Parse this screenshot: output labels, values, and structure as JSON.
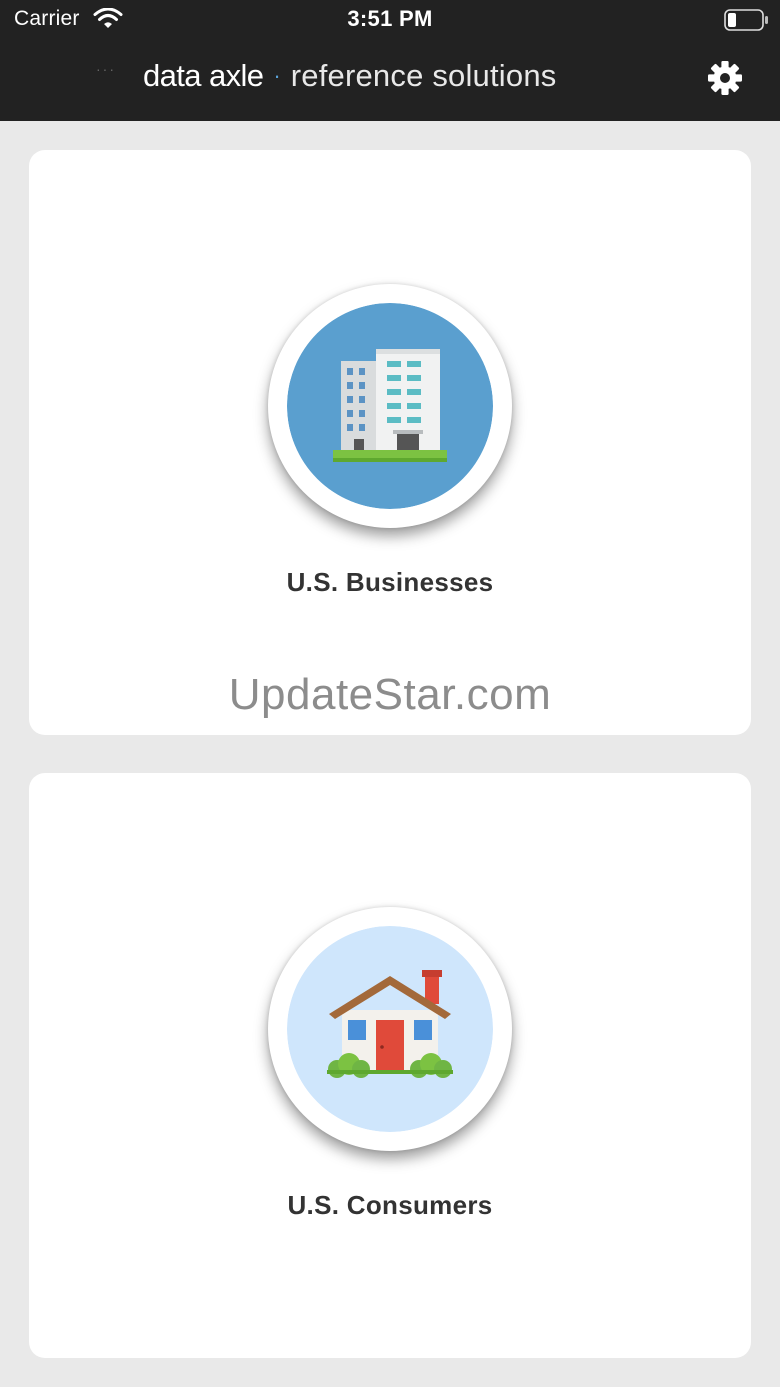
{
  "status_bar": {
    "carrier": "Carrier",
    "time": "3:51 PM"
  },
  "header": {
    "brand_name": "data axle",
    "brand_separator": "·",
    "brand_sub": "reference solutions",
    "dots": "···",
    "settings_icon": "gear-icon"
  },
  "cards": [
    {
      "label": "U.S. Businesses",
      "icon": "office-building-icon",
      "disc_color": "#5a9fcf"
    },
    {
      "label": "U.S. Consumers",
      "icon": "house-icon",
      "disc_color": "#cfe6fc"
    }
  ],
  "watermark": "UpdateStar.com",
  "colors": {
    "header_bg": "#222222",
    "page_bg": "#e9e9e9",
    "accent": "#5aa2d6"
  }
}
